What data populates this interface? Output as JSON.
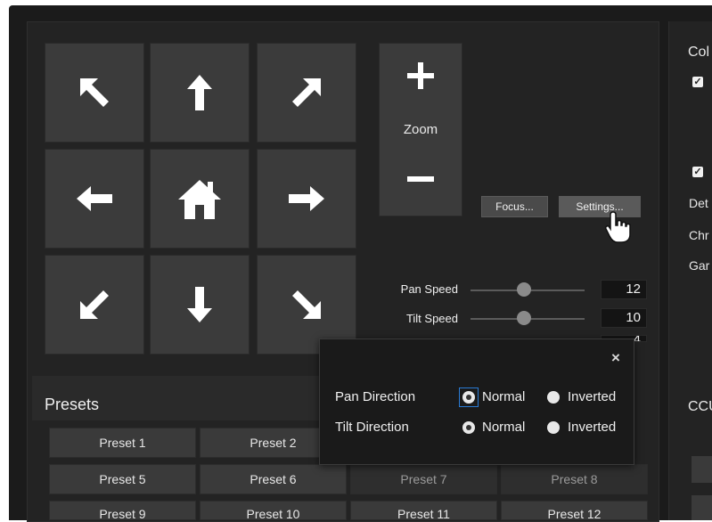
{
  "zoom": {
    "label": "Zoom",
    "plus_icon": "plus-icon",
    "minus_icon": "minus-icon"
  },
  "camera_buttons": {
    "focus": "Focus...",
    "settings": "Settings..."
  },
  "speeds": [
    {
      "label": "Pan Speed",
      "value": "12"
    },
    {
      "label": "Tilt Speed",
      "value": "10"
    }
  ],
  "partial_value": "4",
  "presets": {
    "title": "Presets",
    "items": [
      "Preset 1",
      "Preset 2",
      "Preset 5",
      "Preset 6",
      "Preset 7",
      "Preset 8",
      "Preset 9",
      "Preset 10",
      "Preset 11",
      "Preset 12"
    ]
  },
  "direction_popup": {
    "close": "×",
    "pan_label": "Pan Direction",
    "tilt_label": "Tilt Direction",
    "normal": "Normal",
    "inverted": "Inverted",
    "pan_selected": "Normal",
    "tilt_selected": "Normal"
  },
  "right_panel": {
    "title": "Col",
    "rows": [
      "Det",
      "Chr",
      "Gar"
    ],
    "ccu_title": "CCU"
  },
  "colors": {
    "focus_ring": "#2a7bd4"
  }
}
